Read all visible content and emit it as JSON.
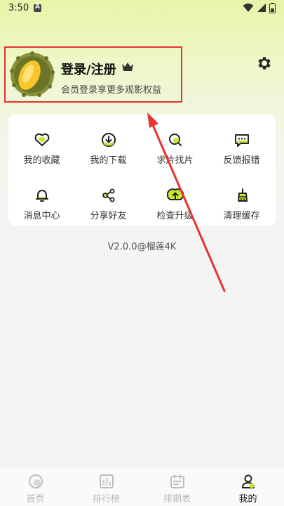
{
  "status_bar": {
    "time": "3:50"
  },
  "profile": {
    "title": "登录/注册",
    "subtitle": "会员登录享更多观影权益"
  },
  "grid": [
    {
      "label": "我的收藏",
      "icon": "heart-icon"
    },
    {
      "label": "我的下载",
      "icon": "download-icon"
    },
    {
      "label": "求片找片",
      "icon": "search-film-icon"
    },
    {
      "label": "反馈报错",
      "icon": "feedback-icon"
    },
    {
      "label": "消息中心",
      "icon": "bell-icon"
    },
    {
      "label": "分享好友",
      "icon": "share-icon"
    },
    {
      "label": "检查升级",
      "icon": "upgrade-icon"
    },
    {
      "label": "清理缓存",
      "icon": "broom-icon"
    }
  ],
  "version": "V2.0.0@榴莲4K",
  "bottom_nav": [
    {
      "label": "首页",
      "icon": "home-icon"
    },
    {
      "label": "排行榜",
      "icon": "ranking-icon"
    },
    {
      "label": "排期表",
      "icon": "calendar-icon"
    },
    {
      "label": "我的",
      "icon": "me-icon",
      "active": true
    }
  ],
  "colors": {
    "accent": "#c8e62e",
    "highlight_border": "#e8322f",
    "arrow": "#e8322f"
  }
}
